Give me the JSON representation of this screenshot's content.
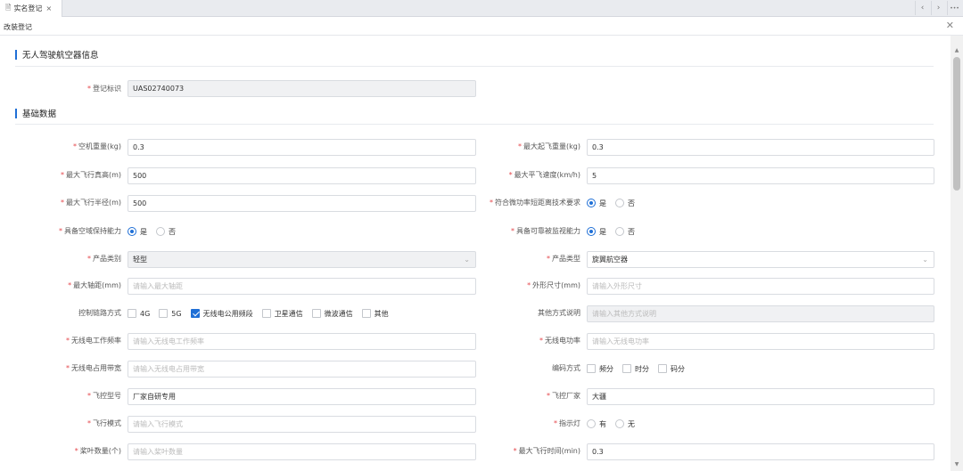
{
  "tabs": [
    {
      "label": "实名登记",
      "close": "×"
    }
  ],
  "tab_nav": {
    "prev": "‹",
    "next": "›",
    "more": "•••"
  },
  "subtitle": "改装登记",
  "sections": {
    "info_title": "无人驾驶航空器信息",
    "basic_title": "基础数据"
  },
  "fields": {
    "reg_id": {
      "label": "登记标识",
      "value": "UAS02740073"
    },
    "empty_weight": {
      "label": "空机重量(kg)",
      "value": "0.3"
    },
    "max_takeoff_weight": {
      "label": "最大起飞重量(kg)",
      "value": "0.3"
    },
    "max_altitude": {
      "label": "最大飞行真高(m)",
      "value": "500"
    },
    "max_speed": {
      "label": "最大平飞速度(km/h)",
      "value": "5"
    },
    "max_radius": {
      "label": "最大飞行半径(m)",
      "value": "500"
    },
    "micro_power": {
      "label": "符合微功率短距离技术要求",
      "yes": "是",
      "no": "否",
      "selected": "是"
    },
    "airspace_keep": {
      "label": "具备空域保持能力",
      "yes": "是",
      "no": "否",
      "selected": "是"
    },
    "monitorable": {
      "label": "具备可靠被监视能力",
      "yes": "是",
      "no": "否",
      "selected": "是"
    },
    "product_category": {
      "label": "产品类别",
      "value": "轻型",
      "arrow": "⌄"
    },
    "product_type": {
      "label": "产品类型",
      "value": "旋翼航空器",
      "arrow": "⌄"
    },
    "max_wheelbase": {
      "label": "最大轴距(mm)",
      "placeholder": "请输入最大轴距"
    },
    "outer_size": {
      "label": "外形尺寸(mm)",
      "placeholder": "请输入外形尺寸"
    },
    "control_link": {
      "label": "控制链路方式",
      "options": [
        {
          "text": "4G",
          "checked": false
        },
        {
          "text": "5G",
          "checked": false
        },
        {
          "text": "无线电公用频段",
          "checked": true
        },
        {
          "text": "卫星通信",
          "checked": false
        },
        {
          "text": "微波通信",
          "checked": false
        },
        {
          "text": "其他",
          "checked": false
        }
      ]
    },
    "other_method": {
      "label": "其他方式说明",
      "placeholder": "请输入其他方式说明"
    },
    "radio_freq": {
      "label": "无线电工作频率",
      "placeholder": "请输入无线电工作频率"
    },
    "radio_power": {
      "label": "无线电功率",
      "placeholder": "请输入无线电功率"
    },
    "radio_bandwidth": {
      "label": "无线电占用带宽",
      "placeholder": "请输入无线电占用带宽"
    },
    "encoding": {
      "label": "编码方式",
      "options": [
        {
          "text": "频分",
          "checked": false
        },
        {
          "text": "时分",
          "checked": false
        },
        {
          "text": "码分",
          "checked": false
        }
      ]
    },
    "fc_model": {
      "label": "飞控型号",
      "value": "厂家自研专用"
    },
    "fc_maker": {
      "label": "飞控厂家",
      "value": "大疆"
    },
    "flight_mode": {
      "label": "飞行模式",
      "placeholder": "请输入飞行模式"
    },
    "indicator": {
      "label": "指示灯",
      "yes": "有",
      "no": "无",
      "selected": ""
    },
    "blade_count": {
      "label": "桨叶数量(个)",
      "placeholder": "请输入桨叶数量"
    },
    "max_flight_time": {
      "label": "最大飞行时间(min)",
      "value": "0.3"
    }
  },
  "colors": {
    "accent": "#1f6fd6",
    "required": "#e5484d"
  }
}
